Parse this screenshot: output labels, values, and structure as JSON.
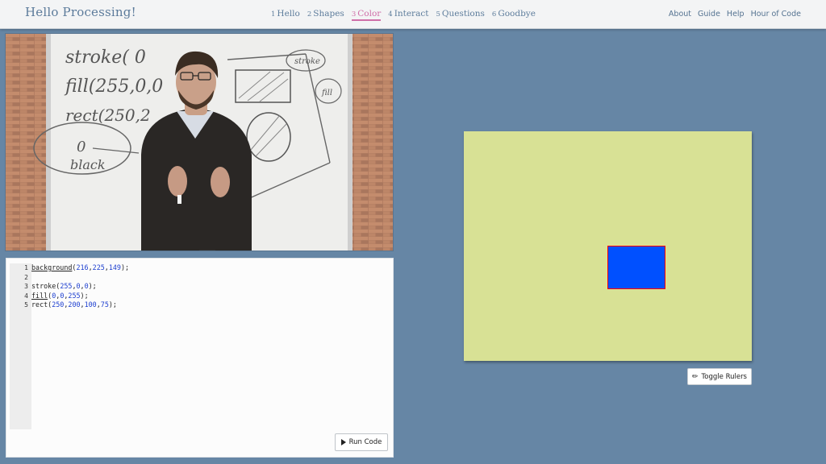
{
  "header": {
    "title": "Hello Processing!",
    "lessons": [
      {
        "num": "1",
        "label": "Hello"
      },
      {
        "num": "2",
        "label": "Shapes"
      },
      {
        "num": "3",
        "label": "Color"
      },
      {
        "num": "4",
        "label": "Interact"
      },
      {
        "num": "5",
        "label": "Questions"
      },
      {
        "num": "6",
        "label": "Goodbye"
      }
    ],
    "nav": [
      "About",
      "Guide",
      "Help",
      "Hour of Code"
    ]
  },
  "video": {
    "whiteboard_text": [
      "stroke( 0",
      "fill(255,0,0",
      "rect(250,2",
      "0",
      "black",
      "stroke",
      "fill"
    ]
  },
  "editor": {
    "line_numbers": [
      "1",
      "2",
      "3",
      "4",
      "5"
    ],
    "lines": [
      {
        "fn": "background",
        "args": [
          "216",
          "225",
          "149"
        ]
      },
      null,
      {
        "fn": "stroke",
        "args": [
          "255",
          "0",
          "0"
        ]
      },
      {
        "fn": "fill",
        "args": [
          "0",
          "0",
          "255"
        ]
      },
      {
        "fn": "rect",
        "args": [
          "250",
          "200",
          "100",
          "75"
        ]
      }
    ],
    "run_label": "Run Code",
    "run_icon": "play-icon"
  },
  "sketch": {
    "background_color": "#d8e195",
    "fill_color": "#0050ff",
    "stroke_color": "#ff0000"
  },
  "toggle_rulers": {
    "label": "Toggle Rulers",
    "icon": "pencil-icon"
  }
}
